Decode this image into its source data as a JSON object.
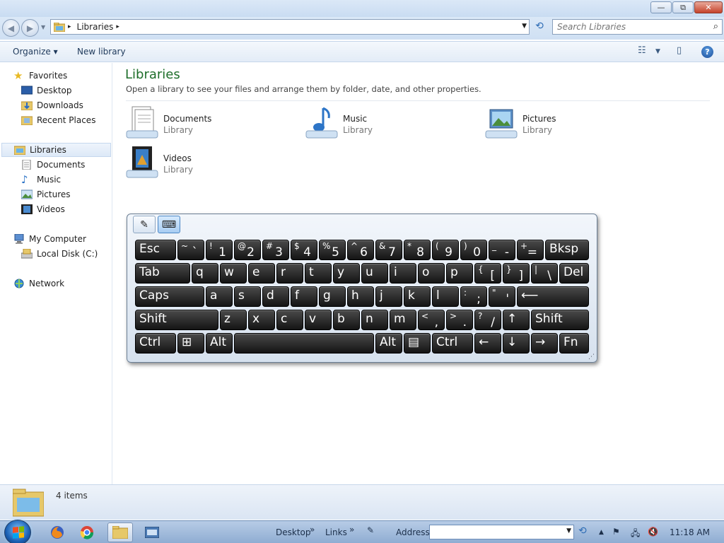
{
  "window": {
    "min_glyph": "—",
    "max_glyph": "⧉",
    "close_glyph": "✕"
  },
  "address": {
    "crumb": "Libraries",
    "sep": "▸"
  },
  "search": {
    "placeholder": "Search Libraries"
  },
  "toolbar": {
    "organize": "Organize ▾",
    "new_library": "New library",
    "help": "?"
  },
  "sidebar": {
    "favorites": "Favorites",
    "desktop": "Desktop",
    "downloads": "Downloads",
    "recent": "Recent Places",
    "libraries": "Libraries",
    "documents": "Documents",
    "music": "Music",
    "pictures": "Pictures",
    "videos": "Videos",
    "computer": "My Computer",
    "localdisk": "Local Disk (C:)",
    "network": "Network"
  },
  "content": {
    "title": "Libraries",
    "description": "Open a library to see your files and arrange them by folder, date, and other properties.",
    "items": [
      {
        "name": "Documents",
        "type": "Library"
      },
      {
        "name": "Music",
        "type": "Library"
      },
      {
        "name": "Pictures",
        "type": "Library"
      },
      {
        "name": "Videos",
        "type": "Library"
      }
    ]
  },
  "keyboard": {
    "rows": [
      [
        {
          "m": "Esc",
          "w": 58
        },
        {
          "s": "~",
          "m": "`",
          "w": 38
        },
        {
          "s": "!",
          "m": "1",
          "w": 38
        },
        {
          "s": "@",
          "m": "2",
          "w": 38
        },
        {
          "s": "#",
          "m": "3",
          "w": 38
        },
        {
          "s": "$",
          "m": "4",
          "w": 38
        },
        {
          "s": "%",
          "m": "5",
          "w": 38
        },
        {
          "s": "^",
          "m": "6",
          "w": 38
        },
        {
          "s": "&",
          "m": "7",
          "w": 38
        },
        {
          "s": "*",
          "m": "8",
          "w": 38
        },
        {
          "s": "(",
          "m": "9",
          "w": 38
        },
        {
          "s": ")",
          "m": "0",
          "w": 38
        },
        {
          "s": "_",
          "m": "-",
          "w": 38
        },
        {
          "s": "+",
          "m": "=",
          "w": 38
        },
        {
          "m": "Bksp",
          "w": 62
        }
      ],
      [
        {
          "m": "Tab",
          "w": 78
        },
        {
          "m": "q",
          "w": 38
        },
        {
          "m": "w",
          "w": 38
        },
        {
          "m": "e",
          "w": 38
        },
        {
          "m": "r",
          "w": 38
        },
        {
          "m": "t",
          "w": 38
        },
        {
          "m": "y",
          "w": 38
        },
        {
          "m": "u",
          "w": 38
        },
        {
          "m": "i",
          "w": 38
        },
        {
          "m": "o",
          "w": 38
        },
        {
          "m": "p",
          "w": 38
        },
        {
          "s": "{",
          "m": "[",
          "w": 38
        },
        {
          "s": "}",
          "m": "]",
          "w": 38
        },
        {
          "s": "|",
          "m": "\\",
          "w": 38
        },
        {
          "m": "Del",
          "w": 42
        }
      ],
      [
        {
          "m": "Caps",
          "w": 98
        },
        {
          "m": "a",
          "w": 38
        },
        {
          "m": "s",
          "w": 38
        },
        {
          "m": "d",
          "w": 38
        },
        {
          "m": "f",
          "w": 38
        },
        {
          "m": "g",
          "w": 38
        },
        {
          "m": "h",
          "w": 38
        },
        {
          "m": "j",
          "w": 38
        },
        {
          "m": "k",
          "w": 38
        },
        {
          "m": "l",
          "w": 38
        },
        {
          "s": ":",
          "m": ";",
          "w": 38
        },
        {
          "s": "\"",
          "m": "'",
          "w": 38
        },
        {
          "m": "⟵",
          "w": 102
        }
      ],
      [
        {
          "m": "Shift",
          "w": 118
        },
        {
          "m": "z",
          "w": 38
        },
        {
          "m": "x",
          "w": 38
        },
        {
          "m": "c",
          "w": 38
        },
        {
          "m": "v",
          "w": 38
        },
        {
          "m": "b",
          "w": 38
        },
        {
          "m": "n",
          "w": 38
        },
        {
          "m": "m",
          "w": 38
        },
        {
          "s": "<",
          "m": ",",
          "w": 38
        },
        {
          "s": ">",
          "m": ".",
          "w": 38
        },
        {
          "s": "?",
          "m": "/",
          "w": 38
        },
        {
          "m": "↑",
          "w": 38
        },
        {
          "m": "Shift",
          "w": 82
        }
      ],
      [
        {
          "m": "Ctrl",
          "w": 58
        },
        {
          "m": "⊞",
          "w": 38
        },
        {
          "m": "Alt",
          "w": 38
        },
        {
          "m": "",
          "w": 198
        },
        {
          "m": "Alt",
          "w": 38
        },
        {
          "m": "▤",
          "w": 38
        },
        {
          "m": "Ctrl",
          "w": 58
        },
        {
          "m": "←",
          "w": 38
        },
        {
          "m": "↓",
          "w": 38
        },
        {
          "m": "→",
          "w": 38
        },
        {
          "m": "Fn",
          "w": 42
        }
      ]
    ]
  },
  "status": {
    "count": "4 items"
  },
  "taskbar": {
    "desktop": "Desktop",
    "links": "Links",
    "address_label": "Address",
    "time": "11:18 AM",
    "chevron": "»"
  }
}
